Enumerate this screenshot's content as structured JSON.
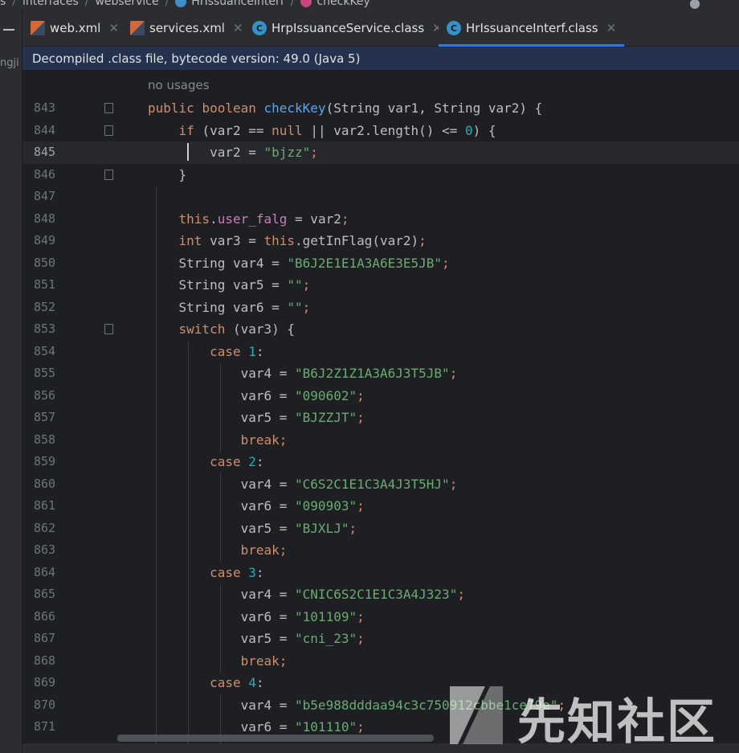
{
  "breadcrumb": {
    "items": [
      "s",
      "interfaces",
      "webservice",
      "HrIssuanceInterf",
      "checkKey"
    ]
  },
  "sidebar": {
    "partial_text": "ngji"
  },
  "tabs": [
    {
      "label": "web.xml",
      "icon": "xml-file-icon",
      "active": false
    },
    {
      "label": "services.xml",
      "icon": "xml-file-icon",
      "active": false
    },
    {
      "label": "HrpIssuanceService.class",
      "icon": "class-file-icon",
      "active": false
    },
    {
      "label": "HrIssuanceInterf.class",
      "icon": "class-file-icon",
      "active": true
    }
  ],
  "banner": {
    "text": "Decompiled .class file, bytecode version: 49.0 (Java 5)"
  },
  "editor": {
    "usages_hint": "no usages",
    "current_line": 845,
    "lines": [
      {
        "n": "843",
        "tokens": [
          [
            "kw",
            "public "
          ],
          [
            "kw",
            "boolean "
          ],
          [
            "fn",
            "checkKey"
          ],
          [
            "p",
            "(String var1, String var2) {"
          ]
        ]
      },
      {
        "n": "844",
        "tokens": [
          [
            "p",
            "    "
          ],
          [
            "kw",
            "if "
          ],
          [
            "p",
            "(var2 == "
          ],
          [
            "kw",
            "null "
          ],
          [
            "p",
            "|| var2.length() <= "
          ],
          [
            "num",
            "0"
          ],
          [
            "p",
            ") {"
          ]
        ]
      },
      {
        "n": "845",
        "tokens": [
          [
            "p",
            "        var2 = "
          ],
          [
            "str",
            "\"bjzz\""
          ],
          [
            "kw",
            ";"
          ]
        ]
      },
      {
        "n": "846",
        "tokens": [
          [
            "p",
            "    }"
          ]
        ]
      },
      {
        "n": "847",
        "tokens": []
      },
      {
        "n": "848",
        "tokens": [
          [
            "p",
            "    "
          ],
          [
            "kw",
            "this"
          ],
          [
            "p",
            "."
          ],
          [
            "fld",
            "user_falg"
          ],
          [
            "p",
            " = var2"
          ],
          [
            "kw",
            ";"
          ]
        ]
      },
      {
        "n": "849",
        "tokens": [
          [
            "p",
            "    "
          ],
          [
            "kw",
            "int "
          ],
          [
            "p",
            "var3 = "
          ],
          [
            "kw",
            "this"
          ],
          [
            "p",
            ".getInFlag(var2)"
          ],
          [
            "kw",
            ";"
          ]
        ]
      },
      {
        "n": "850",
        "tokens": [
          [
            "p",
            "    String var4 = "
          ],
          [
            "str",
            "\"B6J2E1E1A3A6E3E5JB\""
          ],
          [
            "kw",
            ";"
          ]
        ]
      },
      {
        "n": "851",
        "tokens": [
          [
            "p",
            "    String var5 = "
          ],
          [
            "str",
            "\"\""
          ],
          [
            "kw",
            ";"
          ]
        ]
      },
      {
        "n": "852",
        "tokens": [
          [
            "p",
            "    String var6 = "
          ],
          [
            "str",
            "\"\""
          ],
          [
            "kw",
            ";"
          ]
        ]
      },
      {
        "n": "853",
        "tokens": [
          [
            "p",
            "    "
          ],
          [
            "kw",
            "switch "
          ],
          [
            "p",
            "(var3) {"
          ]
        ]
      },
      {
        "n": "854",
        "tokens": [
          [
            "p",
            "        "
          ],
          [
            "kw",
            "case "
          ],
          [
            "num",
            "1"
          ],
          [
            "p",
            ":"
          ]
        ]
      },
      {
        "n": "855",
        "tokens": [
          [
            "p",
            "            var4 = "
          ],
          [
            "str",
            "\"B6J2Z1Z1A3A6J3T5JB\""
          ],
          [
            "kw",
            ";"
          ]
        ]
      },
      {
        "n": "856",
        "tokens": [
          [
            "p",
            "            var6 = "
          ],
          [
            "str",
            "\"090602\""
          ],
          [
            "kw",
            ";"
          ]
        ]
      },
      {
        "n": "857",
        "tokens": [
          [
            "p",
            "            var5 = "
          ],
          [
            "str",
            "\"BJZZJT\""
          ],
          [
            "kw",
            ";"
          ]
        ]
      },
      {
        "n": "858",
        "tokens": [
          [
            "p",
            "            "
          ],
          [
            "kw",
            "break;"
          ]
        ]
      },
      {
        "n": "859",
        "tokens": [
          [
            "p",
            "        "
          ],
          [
            "kw",
            "case "
          ],
          [
            "num",
            "2"
          ],
          [
            "p",
            ":"
          ]
        ]
      },
      {
        "n": "860",
        "tokens": [
          [
            "p",
            "            var4 = "
          ],
          [
            "str",
            "\"C6S2C1E1C3A4J3T5HJ\""
          ],
          [
            "kw",
            ";"
          ]
        ]
      },
      {
        "n": "861",
        "tokens": [
          [
            "p",
            "            var6 = "
          ],
          [
            "str",
            "\"090903\""
          ],
          [
            "kw",
            ";"
          ]
        ]
      },
      {
        "n": "862",
        "tokens": [
          [
            "p",
            "            var5 = "
          ],
          [
            "str",
            "\"BJXLJ\""
          ],
          [
            "kw",
            ";"
          ]
        ]
      },
      {
        "n": "863",
        "tokens": [
          [
            "p",
            "            "
          ],
          [
            "kw",
            "break;"
          ]
        ]
      },
      {
        "n": "864",
        "tokens": [
          [
            "p",
            "        "
          ],
          [
            "kw",
            "case "
          ],
          [
            "num",
            "3"
          ],
          [
            "p",
            ":"
          ]
        ]
      },
      {
        "n": "865",
        "tokens": [
          [
            "p",
            "            var4 = "
          ],
          [
            "str",
            "\"CNIC6S2C1E1C3A4J323\""
          ],
          [
            "kw",
            ";"
          ]
        ]
      },
      {
        "n": "866",
        "tokens": [
          [
            "p",
            "            var6 = "
          ],
          [
            "str",
            "\"101109\""
          ],
          [
            "kw",
            ";"
          ]
        ]
      },
      {
        "n": "867",
        "tokens": [
          [
            "p",
            "            var5 = "
          ],
          [
            "str",
            "\"cni_23\""
          ],
          [
            "kw",
            ";"
          ]
        ]
      },
      {
        "n": "868",
        "tokens": [
          [
            "p",
            "            "
          ],
          [
            "kw",
            "break;"
          ]
        ]
      },
      {
        "n": "869",
        "tokens": [
          [
            "p",
            "        "
          ],
          [
            "kw",
            "case "
          ],
          [
            "num",
            "4"
          ],
          [
            "p",
            ":"
          ]
        ]
      },
      {
        "n": "870",
        "tokens": [
          [
            "p",
            "            var4 = "
          ],
          [
            "str",
            "\"b5e988dddaa94c3c750912cbbe1ce79e\""
          ],
          [
            "kw",
            ";"
          ]
        ]
      },
      {
        "n": "871",
        "tokens": [
          [
            "p",
            "            var6 = "
          ],
          [
            "str",
            "\"101110\""
          ],
          [
            "kw",
            ";"
          ]
        ]
      }
    ]
  },
  "watermark": {
    "text": "先知社区"
  },
  "colors": {
    "keyword": "#cf8e6d",
    "function": "#56a8f5",
    "string": "#6aab73",
    "number": "#2aacb8",
    "field": "#c77dbb",
    "text": "#bcbec4",
    "accent": "#3574f0"
  }
}
